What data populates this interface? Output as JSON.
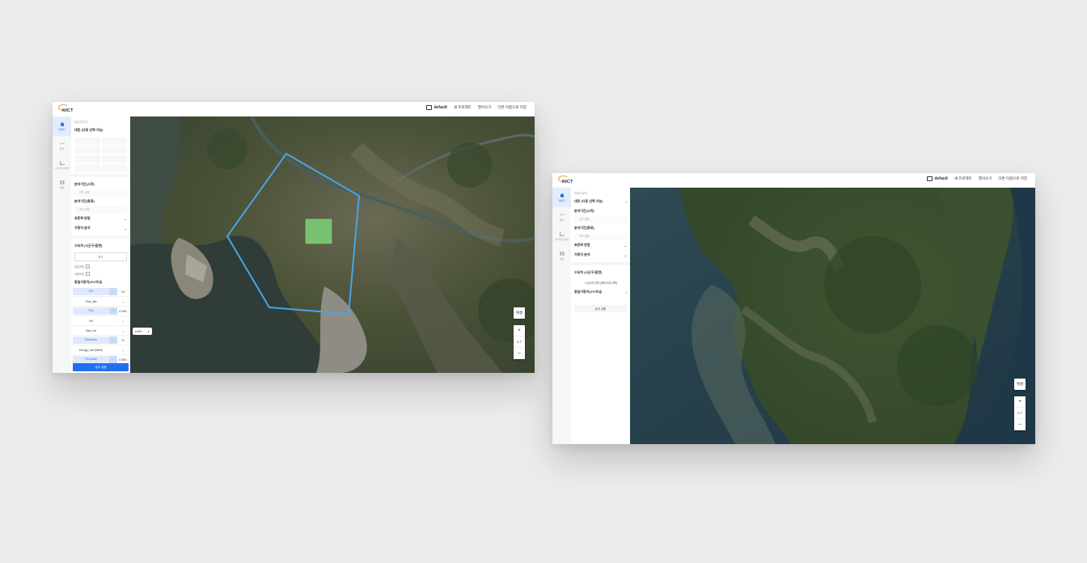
{
  "window1": {
    "logo": "KICT",
    "nav": {
      "project": "default",
      "new_project": "새 프로젝트",
      "open": "열어오기",
      "save_as": "다른 이름으로 저장"
    },
    "rail": [
      {
        "label": "대상지",
        "icon": "home-icon"
      },
      {
        "label": "분석",
        "icon": "chart-icon"
      },
      {
        "label": "시나리오 분석",
        "icon": "bar-icon"
      },
      {
        "label": "설정",
        "icon": "grid-icon"
      }
    ],
    "panel": {
      "breadcrumb": "대상지 분석",
      "target_heading": "대한 (다중 선택 가능)",
      "period1": "분석기간(시작)",
      "period1_sub": "연도 설정",
      "period2": "분석기간(종료)",
      "period2_sub": "연도 설정",
      "method": "표준화 방법",
      "weight": "가중치 분석",
      "water_heading": "수요처 (시군구/읍면)",
      "water_select": "추가",
      "chk1": "일괄적용",
      "chk2": "개별적용",
      "energy_heading": "동일가중치(0%이내)",
      "rows": [
        {
          "name": "Pet",
          "arrow": "→",
          "value": "1%",
          "hl": true
        },
        {
          "name": "Time_ilter",
          "arrow": "–",
          "value": "–",
          "hl": false
        },
        {
          "name": "Tmc",
          "arrow": "+",
          "value": "0.05%",
          "hl": true
        },
        {
          "name": "Vsf",
          "arrow": "–",
          "value": "–",
          "hl": false
        },
        {
          "name": "Max_Vsf",
          "arrow": "–",
          "value": "–",
          "hl": false
        },
        {
          "name": "Emissions",
          "arrow": "→",
          "value": "%",
          "hl": true
        },
        {
          "name": "Energy_Use (MWh)",
          "arrow": "–",
          "value": "–",
          "hl": false
        },
        {
          "name": "PM (total)",
          "arrow": "↑",
          "value": "0.06%",
          "hl": true
        }
      ],
      "run_button": "분석 실행"
    },
    "map": {
      "opacity": "0.0%",
      "basemap_btn": "위성",
      "zoom_in": "+",
      "zoom_level": "2.7",
      "zoom_out": "–"
    }
  },
  "window2": {
    "logo": "KICT",
    "nav": {
      "project": "default",
      "new_project": "새 프로젝트",
      "open": "열어오기",
      "save_as": "다른 이름으로 저장"
    },
    "rail": [
      {
        "label": "대상지",
        "icon": "home-icon"
      },
      {
        "label": "분석",
        "icon": "chart-icon"
      },
      {
        "label": "시나리오 분석",
        "icon": "bar-icon"
      },
      {
        "label": "설정",
        "icon": "grid-icon"
      }
    ],
    "panel": {
      "breadcrumb": "대상지 분석",
      "target_heading": "대한 (다중 선택 가능)",
      "period1": "분석기간(시작)",
      "period1_sub": "연도 설정",
      "period2": "분석기간(종료)",
      "period2_sub": "연도 설정",
      "method": "표준화 방법",
      "weight": "가중치 분석",
      "water_heading": "수요처 (시군구/읍면)",
      "water_add": "+ 수요처 선택 (최대 5개 선택)",
      "energy_heading": "동일가중치(0%이내)",
      "run_button": "분석 실행"
    },
    "map": {
      "basemap_btn": "위성",
      "zoom_in": "+",
      "zoom_level": "2.7",
      "zoom_out": "–"
    }
  }
}
